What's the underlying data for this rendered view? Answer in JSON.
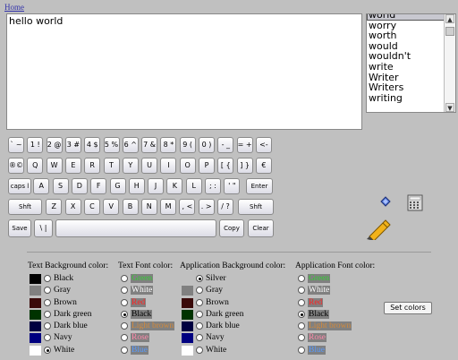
{
  "header": {
    "home_link": "Home"
  },
  "editor": {
    "text": "hello world"
  },
  "suggestions": {
    "items": [
      "world",
      "worry",
      "worth",
      "would",
      "wouldn't",
      "write",
      "Writer",
      "Writers",
      "writing"
    ],
    "selected": "world"
  },
  "keyboard": {
    "row1": [
      "` ~",
      "1 !",
      "2 @",
      "3 #",
      "4 $",
      "5 %",
      "6 ^",
      "7 &",
      "8 *",
      "9 (",
      "0 )",
      "- _",
      "= +",
      "<-"
    ],
    "row2": [
      "®©",
      "Q",
      "W",
      "E",
      "R",
      "T",
      "Y",
      "U",
      "I",
      "O",
      "P",
      "[ {",
      "] }",
      "€"
    ],
    "row3": [
      "caps l",
      "A",
      "S",
      "D",
      "F",
      "G",
      "H",
      "J",
      "K",
      "L",
      "; :",
      "' \"",
      "Enter"
    ],
    "row4": [
      "Shft",
      "Z",
      "X",
      "C",
      "V",
      "B",
      "N",
      "M",
      ", <",
      ". >",
      "/ ?",
      "Shft"
    ],
    "row5": [
      "Save",
      "\\ |",
      "",
      "Copy",
      "Clear"
    ]
  },
  "colors": {
    "text_bg_title": "Text Background color:",
    "text_font_title": "Text Font color:",
    "app_bg_title": "Application Background color:",
    "app_font_title": "Application Font color:",
    "text_bg": [
      {
        "label": "Black",
        "color": "#000000",
        "selected": false
      },
      {
        "label": "Gray",
        "color": "#808080",
        "selected": false
      },
      {
        "label": "Brown",
        "color": "#3a0a0a",
        "selected": false
      },
      {
        "label": "Dark green",
        "color": "#003300",
        "selected": false
      },
      {
        "label": "Dark blue",
        "color": "#000040",
        "selected": false
      },
      {
        "label": "Navy",
        "color": "#000080",
        "selected": false
      },
      {
        "label": "White",
        "color": "#ffffff",
        "selected": true
      }
    ],
    "text_font": [
      {
        "label": "Green",
        "color": "#33cc33",
        "selected": false
      },
      {
        "label": "White",
        "color": "#ffffff",
        "selected": false
      },
      {
        "label": "Red",
        "color": "#ff2222",
        "selected": false
      },
      {
        "label": "Black",
        "color": "#000000",
        "selected": true
      },
      {
        "label": "Light brown",
        "color": "#d48a3a",
        "selected": false
      },
      {
        "label": "Rose",
        "color": "#ff88aa",
        "selected": false
      },
      {
        "label": "Blue",
        "color": "#5599ff",
        "selected": false
      }
    ],
    "app_bg": [
      {
        "label": "Silver",
        "color": "#c0c0c0",
        "selected": true
      },
      {
        "label": "Gray",
        "color": "#808080",
        "selected": false
      },
      {
        "label": "Brown",
        "color": "#3a0a0a",
        "selected": false
      },
      {
        "label": "Dark green",
        "color": "#003300",
        "selected": false
      },
      {
        "label": "Dark blue",
        "color": "#000040",
        "selected": false
      },
      {
        "label": "Navy",
        "color": "#000080",
        "selected": false
      },
      {
        "label": "White",
        "color": "#ffffff",
        "selected": false
      }
    ],
    "app_font": [
      {
        "label": "Green",
        "color": "#33cc33",
        "selected": false
      },
      {
        "label": "White",
        "color": "#ffffff",
        "selected": false
      },
      {
        "label": "Red",
        "color": "#ff2222",
        "selected": false
      },
      {
        "label": "Black",
        "color": "#000000",
        "selected": true
      },
      {
        "label": "Light brown",
        "color": "#d48a3a",
        "selected": false
      },
      {
        "label": "Rose",
        "color": "#ff88aa",
        "selected": false
      },
      {
        "label": "Blue",
        "color": "#5599ff",
        "selected": false
      }
    ],
    "set_button": "Set colors"
  },
  "icons": [
    "diamond-icon",
    "calculator-icon",
    "pen-icon"
  ]
}
